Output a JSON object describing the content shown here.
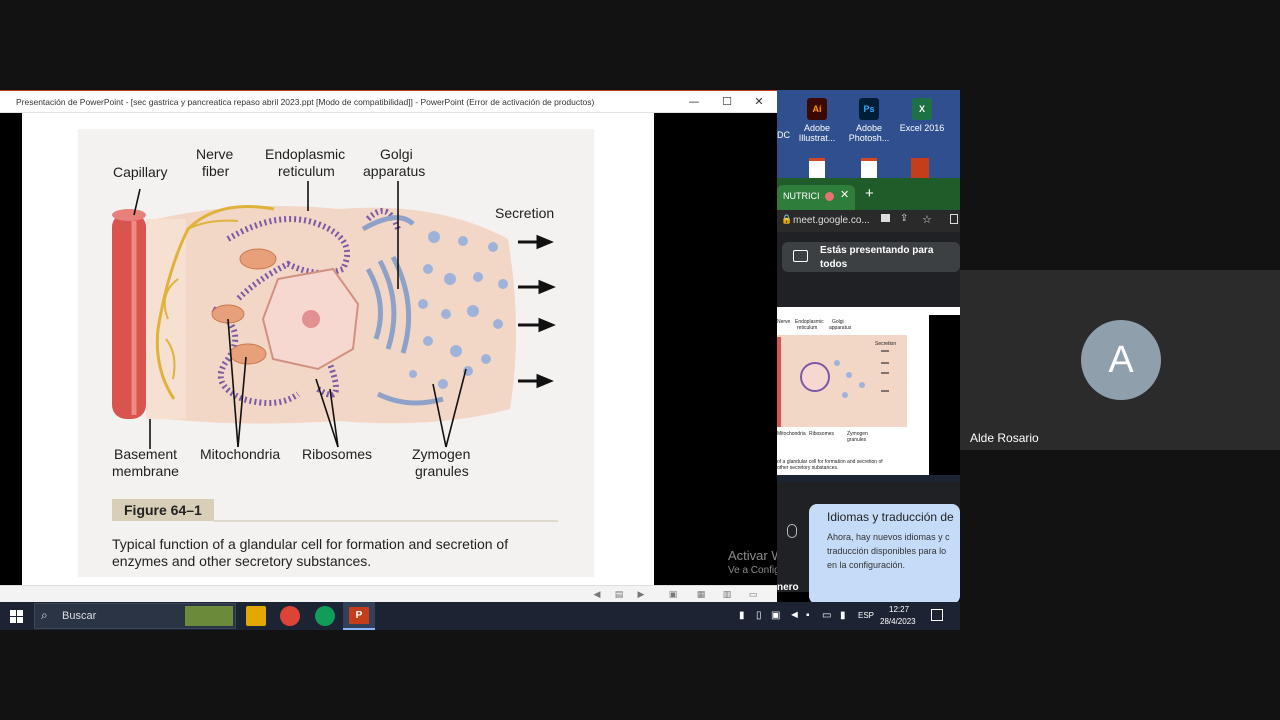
{
  "powerpoint": {
    "title": "Presentación de PowerPoint - [sec gastrica y pancreatica  repaso abril 2023.ppt [Modo de compatibilidad]] - PowerPoint (Error de activación de productos)",
    "minimize": "—",
    "maximize": "☐",
    "close": "✕"
  },
  "slide": {
    "labels": {
      "capillary": "Capillary",
      "nerve": "Nerve",
      "fiber": "fiber",
      "endoplasmic": "Endoplasmic",
      "reticulum": "reticulum",
      "golgi": "Golgi",
      "apparatus": "apparatus",
      "secretion": "Secretion",
      "basement": "Basement",
      "membrane": "membrane",
      "mitochondria": "Mitochondria",
      "ribosomes": "Ribosomes",
      "zymogen": "Zymogen",
      "granules": "granules"
    },
    "figure_label": "Figure 64–1",
    "caption_line1": "Typical function of a glandular cell for formation and secretion of",
    "caption_line2": "enzymes and other secretory substances."
  },
  "watermark": {
    "line1": "Activar Windows",
    "line2": "Ve a Configuración"
  },
  "desktop": {
    "icons": [
      {
        "label": "Adobe Illustrat...",
        "badge": "Ai",
        "color": "#3a0a00"
      },
      {
        "label": "Adobe Photosh...",
        "badge": "Ps",
        "color": "#001e36"
      },
      {
        "label": "Excel 2016",
        "badge": "X",
        "color": "#1e7145"
      }
    ],
    "left_cut": "DC"
  },
  "chrome": {
    "tab_label": "NUTRICI",
    "url": "meet.google.co..."
  },
  "meet": {
    "presenting_line1": "Estás presentando para",
    "presenting_line2": "todos",
    "caption_title": "Idiomas y traducción de",
    "caption_body1": "Ahora, hay nuevos idiomas y c",
    "caption_body2": "traducción disponibles para lo",
    "caption_body3": "en la configuración.",
    "bottom_left": "nero"
  },
  "mini": {
    "endoplasmic": "Endoplasmic",
    "reticulum": "reticulum",
    "golgi": "Golgi",
    "apparatus": "apparatus",
    "secretion": "Secretion",
    "mitochondria": "Mitochondria",
    "ribosomes": "Ribosomes",
    "zymogen": "Zymogen",
    "granules": "granules",
    "nerve": "Nerve",
    "caption1": "of a glandular cell for formation and secretion of",
    "caption2": "other secretory substances."
  },
  "taskbar": {
    "search_label": "Buscar",
    "language": "ESP",
    "time": "12:27",
    "date": "28/4/2023"
  },
  "participant": {
    "initial": "A",
    "name": "Alde Rosario"
  }
}
